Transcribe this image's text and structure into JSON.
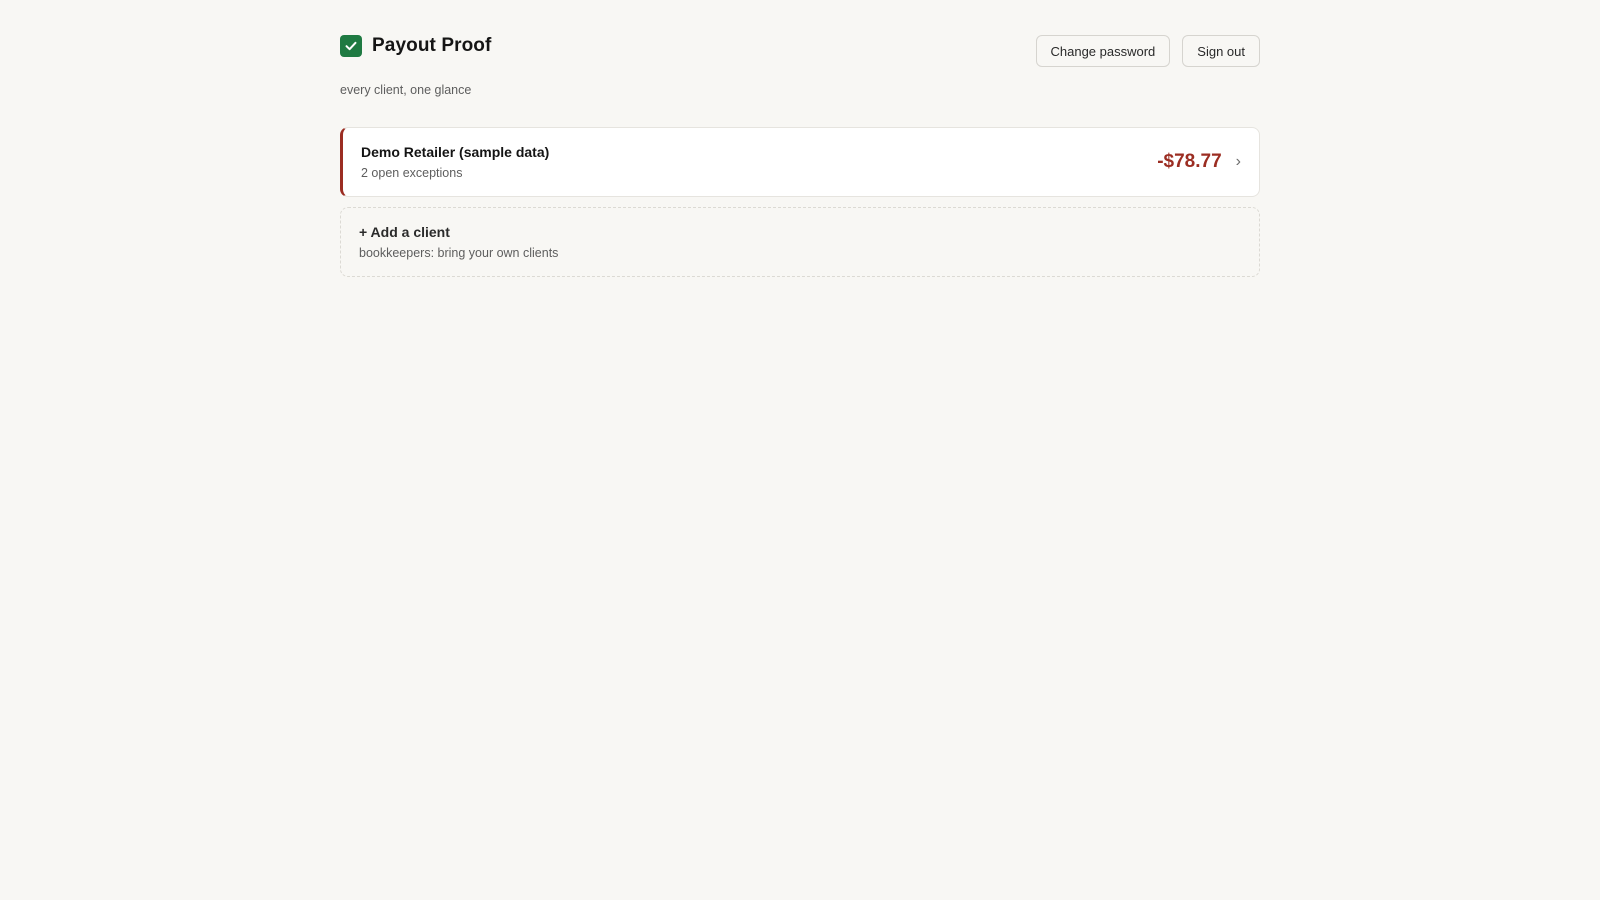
{
  "app": {
    "title": "Payout Proof",
    "tagline": "every client, one glance",
    "brand_color": "#1f7a42"
  },
  "header": {
    "change_password_label": "Change password",
    "sign_out_label": "Sign out"
  },
  "clients": [
    {
      "name": "Demo Retailer (sample data)",
      "status": "2 open exceptions",
      "amount": "-$78.77",
      "accent_color": "#9b2d22",
      "chevron_icon": "chevron-right-icon"
    }
  ],
  "add_client": {
    "title": "+ Add a client",
    "subtitle": "bookkeepers: bring your own clients"
  }
}
